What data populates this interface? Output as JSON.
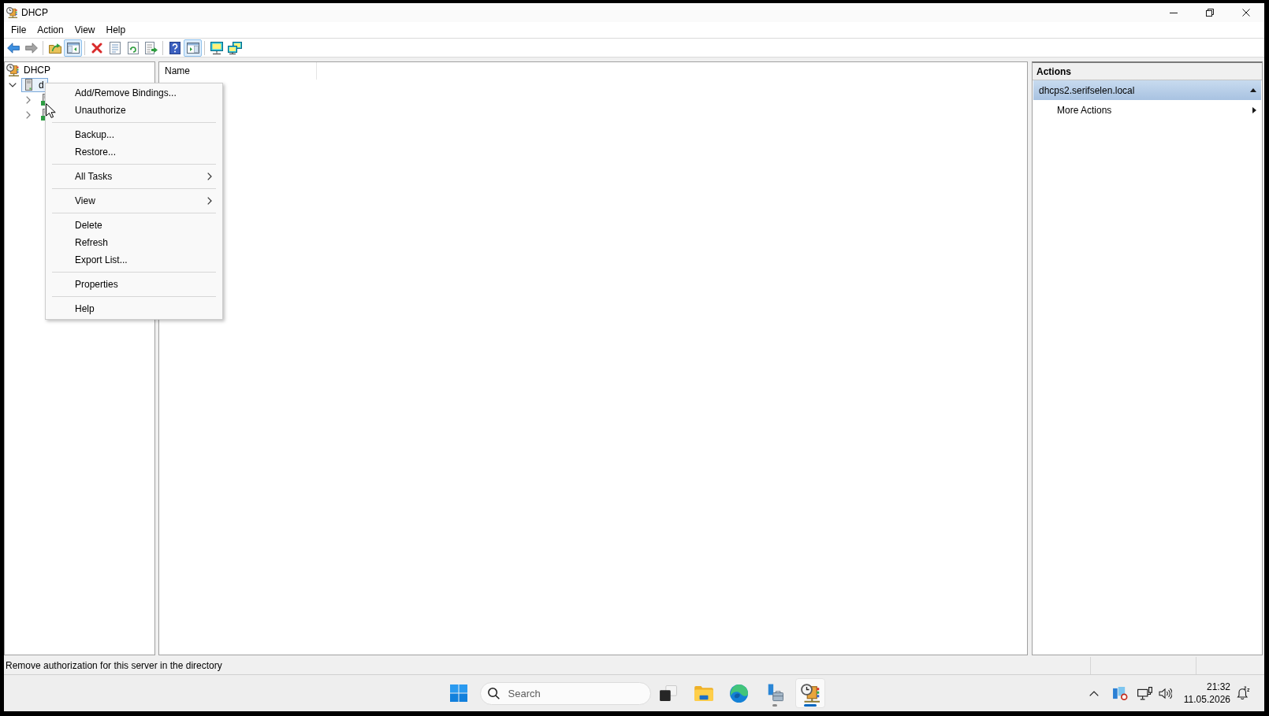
{
  "window": {
    "title": "DHCP"
  },
  "menu_bar": [
    "File",
    "Action",
    "View",
    "Help"
  ],
  "toolbar": {
    "groups": [
      [
        {
          "kind": "back",
          "pressed": false,
          "disabled": false
        },
        {
          "kind": "forward",
          "pressed": false,
          "disabled": true
        }
      ],
      [
        {
          "kind": "up",
          "pressed": false,
          "disabled": false
        },
        {
          "kind": "tree-toggle",
          "pressed": true,
          "disabled": false
        }
      ],
      [
        {
          "kind": "delete",
          "pressed": false,
          "disabled": false
        },
        {
          "kind": "properties",
          "pressed": false,
          "disabled": false
        },
        {
          "kind": "refresh",
          "pressed": false,
          "disabled": false
        },
        {
          "kind": "export",
          "pressed": false,
          "disabled": false
        }
      ],
      [
        {
          "kind": "help",
          "pressed": false,
          "disabled": false
        },
        {
          "kind": "action-toggle",
          "pressed": true,
          "disabled": false
        }
      ],
      [
        {
          "kind": "monitor",
          "pressed": false,
          "disabled": false
        },
        {
          "kind": "network",
          "pressed": false,
          "disabled": false
        }
      ]
    ]
  },
  "tree": [
    {
      "kind": "root",
      "label": "DHCP",
      "selected": false,
      "children": [
        {
          "kind": "server",
          "label": "d",
          "selected": true,
          "expanded": true,
          "children": [
            {
              "kind": "protocol",
              "selected": false,
              "expanded": false
            },
            {
              "kind": "protocol",
              "selected": false,
              "expanded": false
            }
          ]
        }
      ]
    }
  ],
  "list_pane": {
    "columns": [
      "Name"
    ]
  },
  "actions_pane": {
    "title": "Actions",
    "sections": [
      {
        "title": "dhcps2.serifselen.local",
        "expanded": true,
        "items": [
          {
            "label": "More Actions",
            "has_submenu": true
          }
        ]
      }
    ]
  },
  "context_menu": {
    "items": [
      {
        "kind": "item",
        "label": "Add/Remove Bindings...",
        "has_submenu": false
      },
      {
        "kind": "item",
        "label": "Unauthorize",
        "has_submenu": false
      },
      {
        "kind": "separator"
      },
      {
        "kind": "item",
        "label": "Backup...",
        "has_submenu": false
      },
      {
        "kind": "item",
        "label": "Restore...",
        "has_submenu": false
      },
      {
        "kind": "separator"
      },
      {
        "kind": "item",
        "label": "All Tasks",
        "has_submenu": true
      },
      {
        "kind": "separator"
      },
      {
        "kind": "item",
        "label": "View",
        "has_submenu": true
      },
      {
        "kind": "separator"
      },
      {
        "kind": "item",
        "label": "Delete",
        "has_submenu": false
      },
      {
        "kind": "item",
        "label": "Refresh",
        "has_submenu": false
      },
      {
        "kind": "item",
        "label": "Export List...",
        "has_submenu": false
      },
      {
        "kind": "separator"
      },
      {
        "kind": "item",
        "label": "Properties",
        "has_submenu": false
      },
      {
        "kind": "separator"
      },
      {
        "kind": "item",
        "label": "Help",
        "has_submenu": false
      }
    ]
  },
  "status_bar": {
    "text": "Remove authorization for this server in the directory"
  },
  "taskbar": {
    "search": {
      "placeholder": "Search"
    },
    "apps": [
      {
        "kind": "task-view",
        "open": false,
        "selected": false
      },
      {
        "kind": "file-explorer",
        "open": false,
        "selected": false
      },
      {
        "kind": "browser",
        "open": false,
        "selected": false
      },
      {
        "kind": "server-manager",
        "open": true,
        "selected": false
      },
      {
        "kind": "dhcp",
        "open": true,
        "selected": true
      }
    ],
    "clock": {
      "time": "21:32",
      "date": "11.05.2026"
    }
  }
}
